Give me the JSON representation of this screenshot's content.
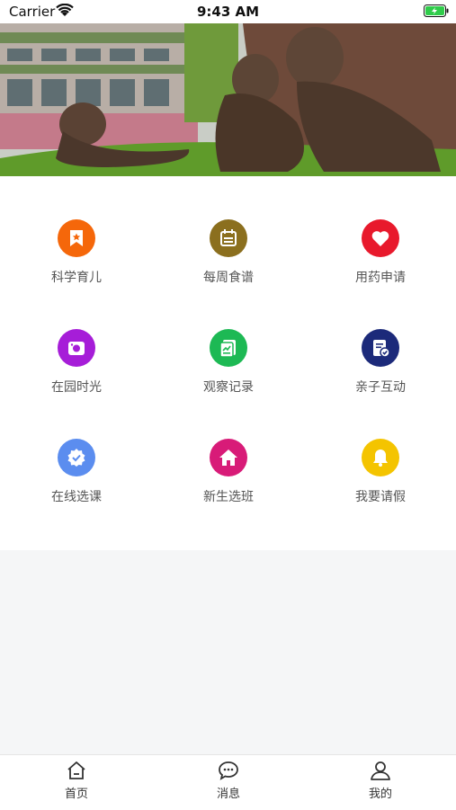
{
  "status_bar": {
    "carrier": "Carrier",
    "time": "9:43 AM"
  },
  "banner": {
    "image": "children-bronze-statues-on-lawn-photo"
  },
  "menu_items": [
    {
      "label": "科学育儿",
      "icon": "bookmark-star-icon",
      "color": "#f5670a"
    },
    {
      "label": "每周食谱",
      "icon": "calendar-icon",
      "color": "#8b6f1e"
    },
    {
      "label": "用药申请",
      "icon": "heart-icon",
      "color": "#e8192c"
    },
    {
      "label": "在园时光",
      "icon": "camera-icon",
      "color": "#a61dd8"
    },
    {
      "label": "观察记录",
      "icon": "chart-note-icon",
      "color": "#1db954"
    },
    {
      "label": "亲子互动",
      "icon": "document-check-icon",
      "color": "#1c2a7a"
    },
    {
      "label": "在线选课",
      "icon": "badge-check-icon",
      "color": "#5b8def"
    },
    {
      "label": "新生选班",
      "icon": "home-icon",
      "color": "#d81b78"
    },
    {
      "label": "我要请假",
      "icon": "bell-icon",
      "color": "#f4c400"
    }
  ],
  "tab_bar": [
    {
      "label": "首页",
      "icon": "home-outline-icon"
    },
    {
      "label": "消息",
      "icon": "chat-bubble-icon"
    },
    {
      "label": "我的",
      "icon": "user-icon"
    }
  ]
}
